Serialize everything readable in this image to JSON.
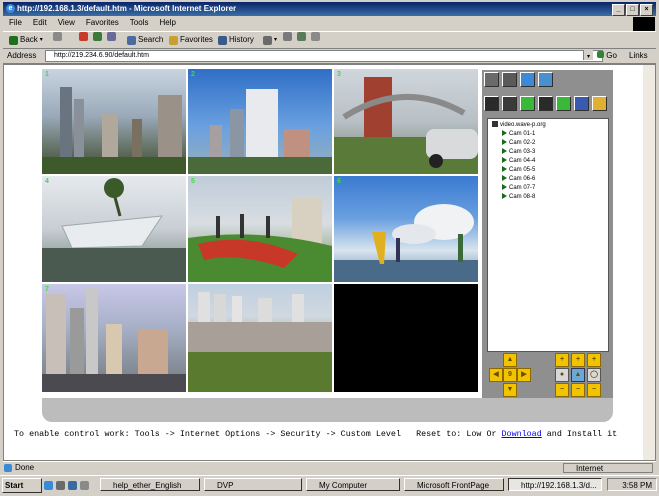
{
  "window": {
    "title": "http://192.168.1.3/default.htm - Microsoft Internet Explorer"
  },
  "menu": {
    "items": [
      "File",
      "Edit",
      "View",
      "Favorites",
      "Tools",
      "Help"
    ]
  },
  "toolbar": {
    "back": "Back",
    "search": "Search",
    "favorites": "Favorites",
    "history": "History"
  },
  "address": {
    "label": "Address",
    "value": "http://219.234.6.90/default.htm",
    "go": "Go",
    "links": "Links"
  },
  "cameras": {
    "tile_numbers": [
      "1",
      "2",
      "3",
      "4",
      "5",
      "6",
      "7",
      "8"
    ]
  },
  "tree": {
    "root": "video.wave-p.org",
    "items": [
      "Cam 01-1",
      "Cam 02-2",
      "Cam 03-3",
      "Cam 04-4",
      "Cam 05-5",
      "Cam 06-6",
      "Cam 07-7",
      "Cam 08-8"
    ]
  },
  "ptz": {
    "center": "9"
  },
  "notice": {
    "main": "To enable control work: Tools -> Internet Options -> Security -> Custom Level",
    "reset": "Reset to: Low Or",
    "link": "Download",
    "tail": "and Install it"
  },
  "status": {
    "left": "Done",
    "zone": "Internet"
  },
  "taskbar": {
    "start": "Start",
    "tasks": [
      "help_ether_English",
      "DVP",
      "My Computer",
      "Microsoft FrontPage",
      "http://192.168.1.3/d..."
    ],
    "time": "3:58 PM"
  }
}
